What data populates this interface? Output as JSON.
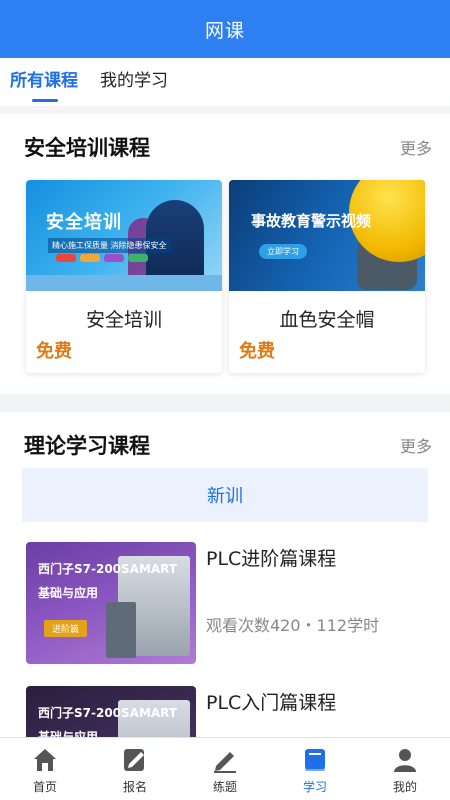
{
  "header": {
    "title": "网课"
  },
  "tabs": [
    {
      "label": "所有课程",
      "active": true
    },
    {
      "label": "我的学习",
      "active": false
    }
  ],
  "safety_section": {
    "title": "安全培训课程",
    "more": "更多",
    "cards": [
      {
        "thumb_title": "安全培训",
        "thumb_sub": "精心施工保质量 消除隐患保安全",
        "name": "安全培训",
        "price": "免费"
      },
      {
        "thumb_title": "事故教育警示视频",
        "thumb_button": "立即学习",
        "name": "血色安全帽",
        "price": "免费"
      }
    ]
  },
  "theory_section": {
    "title": "理论学习课程",
    "more": "更多",
    "filter": "新训",
    "courses": [
      {
        "thumb_line1": "西门子S7-200SAMART",
        "thumb_line2": "基础与应用",
        "thumb_tag": "进阶篇",
        "title": "PLC进阶篇课程",
        "meta": "观看次数420・112学时"
      },
      {
        "thumb_line1": "西门子S7-200SAMART",
        "thumb_line2": "基础与应用",
        "title": "PLC入门篇课程"
      }
    ]
  },
  "bottom_nav": [
    {
      "label": "首页",
      "icon": "home-icon",
      "active": false
    },
    {
      "label": "报名",
      "icon": "signup-icon",
      "active": false
    },
    {
      "label": "练题",
      "icon": "pencil-icon",
      "active": false
    },
    {
      "label": "学习",
      "icon": "book-icon",
      "active": true
    },
    {
      "label": "我的",
      "icon": "user-icon",
      "active": false
    }
  ],
  "colors": {
    "primary": "#2d7ff2",
    "accent_text": "#1f6fe8",
    "price": "#e07a16"
  }
}
